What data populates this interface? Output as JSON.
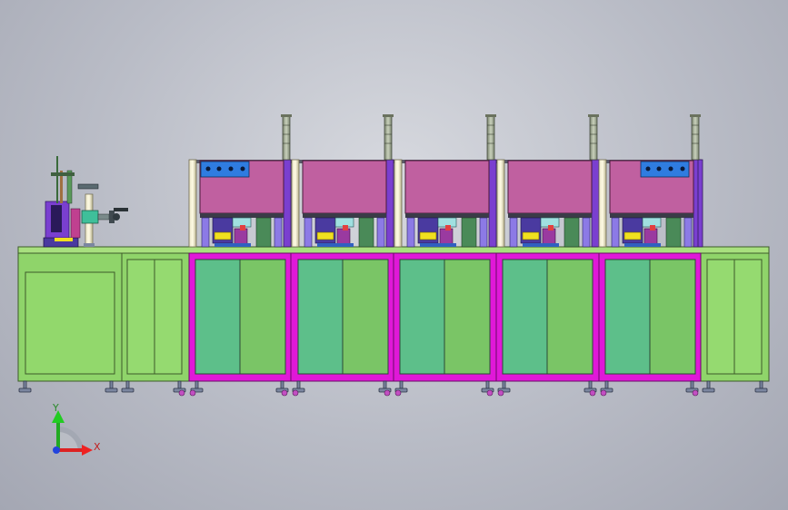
{
  "viewport": {
    "background": "#b9bcc6",
    "colors": {
      "cabinet": "#8fd46a",
      "cabinet_edge": "#3d5a2a",
      "door_teal": "#5dbf8a",
      "door_green": "#7ac566",
      "magenta_frame": "#e018d8",
      "chamber": "#c060a0",
      "blue_plate": "#2f7ce0",
      "column_purple": "#7a3fd0",
      "tower_light": "#9aa890"
    }
  },
  "triad": {
    "x_label": "X",
    "y_label": "Y"
  }
}
